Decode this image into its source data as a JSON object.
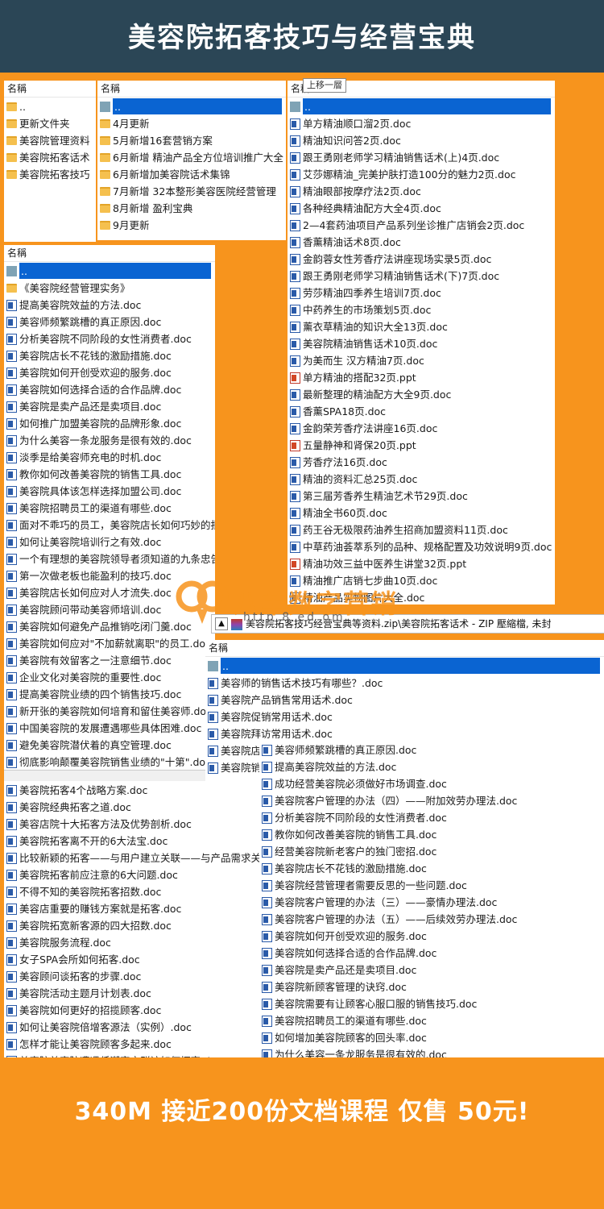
{
  "title": "美容院拓客技巧与经营宝典",
  "footer": "340M 接近200份文档课程 仅售 50元!",
  "header_label": "名稱",
  "tooltip": "上移一層",
  "watermark": {
    "text": "八羊数字营销",
    "url": "http  8  ed   om"
  },
  "zip_path": "美容院拓客技巧经营宝典等资料.zip\\美容院拓客话术 - ZIP 壓縮檔, 未封",
  "panel_a": [
    {
      "t": "..",
      "i": "folder"
    },
    {
      "t": "更新文件夹",
      "i": "folder"
    },
    {
      "t": "美容院管理资料",
      "i": "folder"
    },
    {
      "t": "美容院拓客话术",
      "i": "folder"
    },
    {
      "t": "美容院拓客技巧",
      "i": "folder"
    }
  ],
  "panel_b": [
    {
      "t": "..",
      "i": "up",
      "sel": true
    },
    {
      "t": "4月更新",
      "i": "folder"
    },
    {
      "t": "5月新增16套营销方案",
      "i": "folder"
    },
    {
      "t": "6月新增 精油产品全方位培训推广大全",
      "i": "folder"
    },
    {
      "t": "6月新增加美容院话术集锦",
      "i": "folder"
    },
    {
      "t": "7月新增 32本整形美容医院经营管理",
      "i": "folder"
    },
    {
      "t": "8月新增 盈利宝典",
      "i": "folder"
    },
    {
      "t": "9月更新",
      "i": "folder"
    }
  ],
  "panel_c": [
    {
      "t": "..",
      "i": "up",
      "sel": true
    },
    {
      "t": "单方精油顺口溜2页.doc",
      "i": "doc"
    },
    {
      "t": "精油知识问答2页.doc",
      "i": "doc"
    },
    {
      "t": "跟王勇刚老师学习精油销售话术(上)4页.doc",
      "i": "doc"
    },
    {
      "t": "艾莎娜精油_完美护肤打造100分的魅力2页.doc",
      "i": "doc"
    },
    {
      "t": "精油眼部按摩疗法2页.doc",
      "i": "doc"
    },
    {
      "t": "各种经典精油配方大全4页.doc",
      "i": "doc"
    },
    {
      "t": "2—4套药油项目产品系列坐诊推广店销会2页.doc",
      "i": "doc"
    },
    {
      "t": "香薰精油话术8页.doc",
      "i": "doc"
    },
    {
      "t": "金韵蓉女性芳香疗法讲座现场实录5页.doc",
      "i": "doc"
    },
    {
      "t": "跟王勇刚老师学习精油销售话术(下)7页.doc",
      "i": "doc"
    },
    {
      "t": "劳莎精油四季养生培训7页.doc",
      "i": "doc"
    },
    {
      "t": "中药养生的市场策划5页.doc",
      "i": "doc"
    },
    {
      "t": "薰衣草精油的知识大全13页.doc",
      "i": "doc"
    },
    {
      "t": "美容院精油销售话术10页.doc",
      "i": "doc"
    },
    {
      "t": "为美而生  汉方精油7页.doc",
      "i": "doc"
    },
    {
      "t": "单方精油的搭配32页.ppt",
      "i": "ppt"
    },
    {
      "t": "最新整理的精油配方大全9页.doc",
      "i": "doc"
    },
    {
      "t": "香薰SPA18页.doc",
      "i": "doc"
    },
    {
      "t": "金韵荣芳香疗法讲座16页.doc",
      "i": "doc"
    },
    {
      "t": "五量静神和肾保20页.ppt",
      "i": "ppt"
    },
    {
      "t": "芳香疗法16页.doc",
      "i": "doc"
    },
    {
      "t": "精油的资料汇总25页.doc",
      "i": "doc"
    },
    {
      "t": "第三届芳香养生精油艺术节29页.doc",
      "i": "doc"
    },
    {
      "t": "精油全书60页.doc",
      "i": "doc"
    },
    {
      "t": "药王谷无极限药油养生招商加盟资料11页.doc",
      "i": "doc"
    },
    {
      "t": "中草药油荟萃系列的品种、规格配置及功效说明9页.doc",
      "i": "doc"
    },
    {
      "t": "精油功效三益中医养生讲堂32页.ppt",
      "i": "ppt"
    },
    {
      "t": "精油推广店销七步曲10页.doc",
      "i": "doc"
    },
    {
      "t": "精油产品实物图片大全.doc",
      "i": "doc"
    }
  ],
  "panel_d": [
    {
      "t": "..",
      "i": "up",
      "sel": true
    },
    {
      "t": "《美容院经营管理实务》",
      "i": "folder"
    },
    {
      "t": "提高美容院效益的方法.doc",
      "i": "doc"
    },
    {
      "t": "美容师频繁跳槽的真正原因.doc",
      "i": "doc"
    },
    {
      "t": "分析美容院不同阶段的女性消费者.doc",
      "i": "doc"
    },
    {
      "t": "美容院店长不花钱的激励措施.doc",
      "i": "doc"
    },
    {
      "t": "美容院如何开创受欢迎的服务.doc",
      "i": "doc"
    },
    {
      "t": "美容院如何选择合适的合作品牌.doc",
      "i": "doc"
    },
    {
      "t": "美容院是卖产品还是卖项目.doc",
      "i": "doc"
    },
    {
      "t": "如何推广加盟美容院的品牌形象.doc",
      "i": "doc"
    },
    {
      "t": "为什么美容一条龙服务是很有效的.doc",
      "i": "doc"
    },
    {
      "t": "淡季是给美容师充电的时机.doc",
      "i": "doc"
    },
    {
      "t": "教你如何改善美容院的销售工具.doc",
      "i": "doc"
    },
    {
      "t": "美容院具体该怎样选择加盟公司.doc",
      "i": "doc"
    },
    {
      "t": "美容院招聘员工的渠道有哪些.doc",
      "i": "doc"
    },
    {
      "t": "面对不乖巧的员工，美容院店长如何巧妙的批",
      "i": "doc"
    },
    {
      "t": "如何让美容院培训行之有效.doc",
      "i": "doc"
    },
    {
      "t": "一个有理想的美容院领导者须知道的九条忠告",
      "i": "doc"
    },
    {
      "t": "第一次做老板也能盈利的技巧.doc",
      "i": "doc"
    },
    {
      "t": "美容院店长如何应对人才流失.doc",
      "i": "doc"
    },
    {
      "t": "美容院顾问带动美容师培训.doc",
      "i": "doc"
    },
    {
      "t": "美容院如何避免产品推销吃闭门羹.doc",
      "i": "doc"
    },
    {
      "t": "美容院如何应对\"不加薪就离职\"的员工.doc",
      "i": "doc"
    },
    {
      "t": "美容院有效留客之一注意细节.doc",
      "i": "doc"
    },
    {
      "t": "企业文化对美容院的重要性.doc",
      "i": "doc"
    },
    {
      "t": "提高美容院业绩的四个销售技巧.doc",
      "i": "doc"
    },
    {
      "t": "新开张的美容院如何培育和留住美容师.doc",
      "i": "doc"
    },
    {
      "t": "中国美容院的发展遭遇哪些具体困难.doc",
      "i": "doc"
    },
    {
      "t": "避免美容院潜伏着的真空管理.doc",
      "i": "doc"
    },
    {
      "t": "彻底影响颠覆美容院销售业绩的\"十第\".doc",
      "i": "doc"
    }
  ],
  "panel_e": [
    {
      "t": "美容院拓客4个战略方案.doc",
      "i": "doc"
    },
    {
      "t": "美容院经典拓客之道.doc",
      "i": "doc"
    },
    {
      "t": "美容店院十大拓客方法及优势剖析.doc",
      "i": "doc"
    },
    {
      "t": "美容院拓客离不开的6大法宝.doc",
      "i": "doc"
    },
    {
      "t": "比较新颖的拓客——与用户建立关联——与产品需求关",
      "i": "doc"
    },
    {
      "t": "美容院拓客前应注意的6大问题.doc",
      "i": "doc"
    },
    {
      "t": "不得不知的美容院拓客招数.doc",
      "i": "doc"
    },
    {
      "t": "美容店重要的赚钱方案就是拓客.doc",
      "i": "doc"
    },
    {
      "t": "美容院拓宽新客源的四大招数.doc",
      "i": "doc"
    },
    {
      "t": "美容院服务流程.doc",
      "i": "doc"
    },
    {
      "t": "女子SPA会所如何拓客.doc",
      "i": "doc"
    },
    {
      "t": "美容顾问谈拓客的步骤.doc",
      "i": "doc"
    },
    {
      "t": "美容院活动主题月计划表.doc",
      "i": "doc"
    },
    {
      "t": "美容院如何更好的招揽顾客.doc",
      "i": "doc"
    },
    {
      "t": "如何让美容院倍增客源法（实例）.doc",
      "i": "doc"
    },
    {
      "t": "怎样才能让美容院顾客多起来.doc",
      "i": "doc"
    },
    {
      "t": "美容院美容院遭遇低潮客户群该如何拓客.doc",
      "i": "doc"
    }
  ],
  "panel_f": [
    {
      "t": "..",
      "i": "up",
      "sel": true
    },
    {
      "t": "美容师的销售话术技巧有哪些？.doc",
      "i": "doc"
    },
    {
      "t": "美容院产品销售常用话术.doc",
      "i": "doc"
    },
    {
      "t": "美容院促销常用话术.doc",
      "i": "doc"
    },
    {
      "t": "美容院拜访常用话术.doc",
      "i": "doc"
    },
    {
      "t": "美容院店长经营话术.doc",
      "i": "doc"
    },
    {
      "t": "美容院销售话术大全.doc",
      "i": "doc"
    }
  ],
  "panel_g": [
    {
      "t": "美容师频繁跳槽的真正原因.doc",
      "i": "doc"
    },
    {
      "t": "提高美容院效益的方法.doc",
      "i": "doc"
    },
    {
      "t": "成功经营美容院必须做好市场调查.doc",
      "i": "doc"
    },
    {
      "t": "美容院客户管理的办法（四）——附加效劳办理法.doc",
      "i": "doc"
    },
    {
      "t": "分析美容院不同阶段的女性消费者.doc",
      "i": "doc"
    },
    {
      "t": "教你如何改善美容院的销售工具.doc",
      "i": "doc"
    },
    {
      "t": "经营美容院新老客户的独门密招.doc",
      "i": "doc"
    },
    {
      "t": "美容院店长不花钱的激励措施.doc",
      "i": "doc"
    },
    {
      "t": "美容院经营管理者需要反思的一些问题.doc",
      "i": "doc"
    },
    {
      "t": "美容院客户管理的办法（三）——豪情办理法.doc",
      "i": "doc"
    },
    {
      "t": "美容院客户管理的办法（五）——后续效劳办理法.doc",
      "i": "doc"
    },
    {
      "t": "美容院如何开创受欢迎的服务.doc",
      "i": "doc"
    },
    {
      "t": "美容院如何选择合适的合作品牌.doc",
      "i": "doc"
    },
    {
      "t": "美容院是卖产品还是卖项目.doc",
      "i": "doc"
    },
    {
      "t": "美容院新顾客管理的诀窍.doc",
      "i": "doc"
    },
    {
      "t": "美容院需要有让顾客心服口服的销售技巧.doc",
      "i": "doc"
    },
    {
      "t": "美容院招聘员工的渠道有哪些.doc",
      "i": "doc"
    },
    {
      "t": "如何增加美容院顾客的回头率.doc",
      "i": "doc"
    },
    {
      "t": "为什么美容一条龙服务是很有效的.doc",
      "i": "doc"
    }
  ]
}
